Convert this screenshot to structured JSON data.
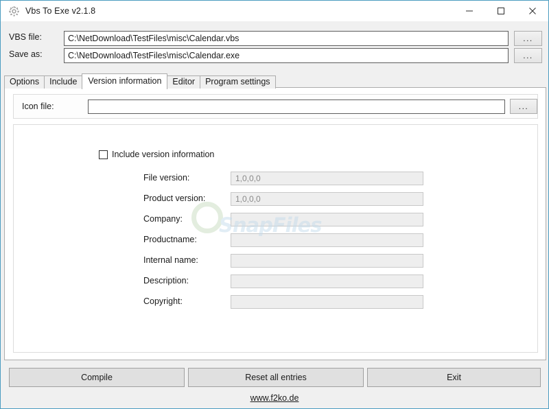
{
  "window": {
    "title": "Vbs To Exe v2.1.8",
    "icon": "gear-icon",
    "border_color": "#4a9cc0",
    "controls": {
      "minimize": "minimize-icon",
      "maximize": "maximize-icon",
      "close": "close-icon"
    }
  },
  "file_fields": [
    {
      "label": "VBS file:",
      "value": "C:\\NetDownload\\TestFiles\\misc\\Calendar.vbs",
      "browse_label": "...",
      "placeholder": ""
    },
    {
      "label": "Save as:",
      "value": "C:\\NetDownload\\TestFiles\\misc\\Calendar.exe",
      "browse_label": "...",
      "placeholder": ""
    }
  ],
  "tabs": [
    {
      "label": "Options",
      "active": false
    },
    {
      "label": "Include",
      "active": false
    },
    {
      "label": "Version information",
      "active": true
    },
    {
      "label": "Editor",
      "active": false
    },
    {
      "label": "Program settings",
      "active": false
    }
  ],
  "version_tab": {
    "icon_file": {
      "label": "Icon file:",
      "value": "",
      "placeholder": "",
      "browse_label": "..."
    },
    "include_checkbox": {
      "label": "Include version information",
      "checked": false
    },
    "fields": [
      {
        "label": "File version:",
        "value": "1,0,0,0"
      },
      {
        "label": "Product version:",
        "value": "1,0,0,0"
      },
      {
        "label": "Company:",
        "value": ""
      },
      {
        "label": "Productname:",
        "value": ""
      },
      {
        "label": "Internal name:",
        "value": ""
      },
      {
        "label": "Description:",
        "value": ""
      },
      {
        "label": "Copyright:",
        "value": ""
      }
    ]
  },
  "watermark": {
    "text": "SnapFiles",
    "ring_color": "#c9ddc0",
    "text_color": "#c5dcec"
  },
  "bottom": {
    "buttons": [
      {
        "label": "Compile"
      },
      {
        "label": "Reset all entries"
      },
      {
        "label": "Exit"
      }
    ],
    "footer_link": "www.f2ko.de"
  }
}
